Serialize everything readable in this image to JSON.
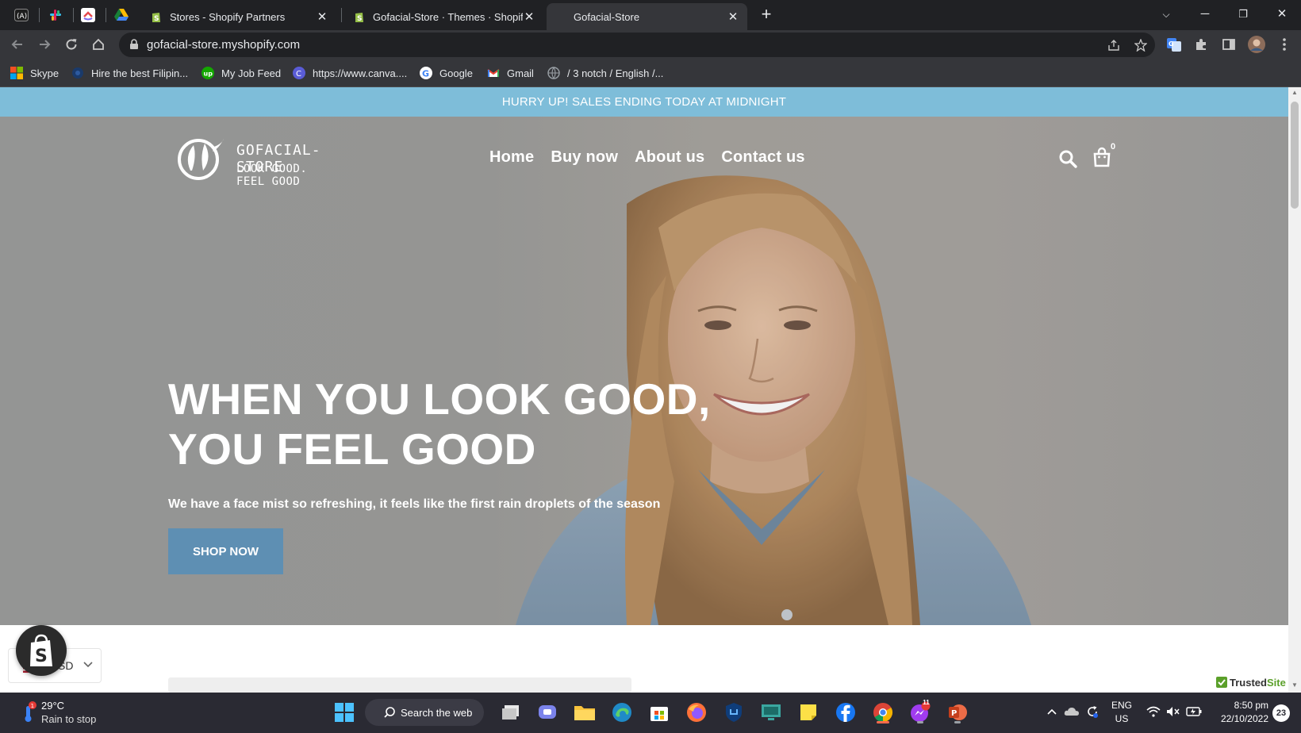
{
  "browser": {
    "tabs": [
      {
        "title": "Stores - Shopify Partners",
        "active": false
      },
      {
        "title": "Gofacial-Store · Themes · Shopify",
        "active": false
      },
      {
        "title": "Gofacial-Store",
        "active": true
      }
    ],
    "pinned_tabs": [
      "app-icon",
      "slack-icon",
      "clickup-icon",
      "google-drive-icon"
    ],
    "url": "gofacial-store.myshopify.com",
    "bookmarks": [
      "Skype",
      "Hire the best Filipin...",
      "My Job Feed",
      "https://www.canva....",
      "Google",
      "Gmail",
      "/ 3 notch / English /..."
    ]
  },
  "store": {
    "announcement": "HURRY UP! SALES ENDING TODAY AT MIDNIGHT",
    "logo_line1": "GOFACIAL-STORE",
    "logo_line2": "LOOK GOOD. FEEL GOOD",
    "nav": [
      "Home",
      "Buy now",
      "About us",
      "Contact us"
    ],
    "cart_count": "0",
    "hero_title_line1": "WHEN YOU LOOK GOOD,",
    "hero_title_line2": "YOU FEEL GOOD",
    "hero_subtitle": "We have a face mist so refreshing, it feels like the first rain droplets of the season",
    "cta_label": "SHOP NOW",
    "currency": "USD",
    "currency_visible": "SD",
    "trusted_label": "Trusted",
    "trusted_site": "Site"
  },
  "taskbar": {
    "weather_temp": "29°C",
    "weather_condition": "Rain to stop",
    "weather_badge": "1",
    "search_placeholder": "Search the web",
    "lang_line1": "ENG",
    "lang_line2": "US",
    "time": "8:50 pm",
    "date": "22/10/2022",
    "notification_count": "23",
    "messenger_badge": "11"
  },
  "colors": {
    "announcement_bg": "#7ebdd9",
    "cta_bg": "#5e8fb3",
    "browser_bg": "#202124",
    "toolbar_bg": "#35363a",
    "taskbar_bg": "#2a2a33"
  }
}
